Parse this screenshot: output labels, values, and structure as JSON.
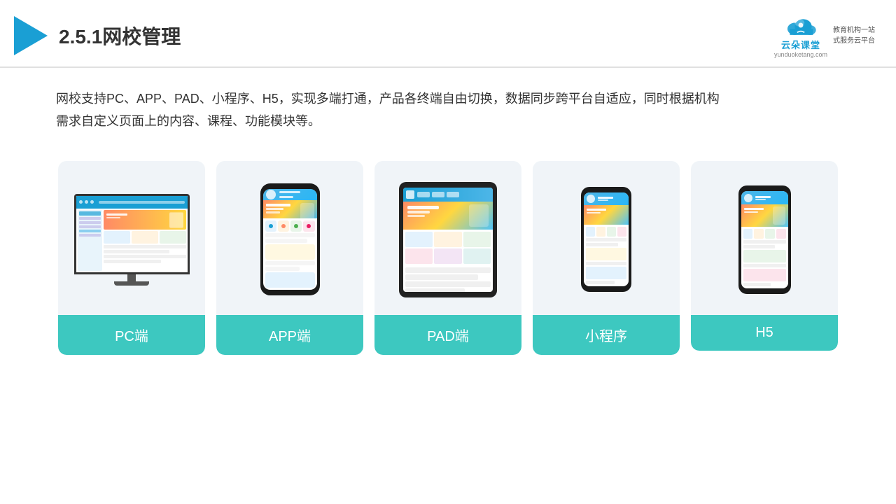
{
  "header": {
    "title": "2.5.1网校管理",
    "brand": {
      "name": "云朵课堂",
      "url": "yunduoketang.com",
      "tagline": "教育机构一站\n式服务云平台"
    }
  },
  "description": {
    "text1": "网校支持PC、APP、PAD、小程序、H5，实现多端打通，产品各终端自由切换，数据同步跨平台自适应，同时根据机构",
    "text2": "需求自定义页面上的内容、课程、功能模块等。"
  },
  "cards": [
    {
      "id": "pc",
      "label": "PC端"
    },
    {
      "id": "app",
      "label": "APP端"
    },
    {
      "id": "pad",
      "label": "PAD端"
    },
    {
      "id": "miniprogram",
      "label": "小程序"
    },
    {
      "id": "h5",
      "label": "H5"
    }
  ],
  "colors": {
    "teal": "#3dc8c0",
    "blue": "#1a9fd4",
    "accent": "#ff8a65"
  }
}
